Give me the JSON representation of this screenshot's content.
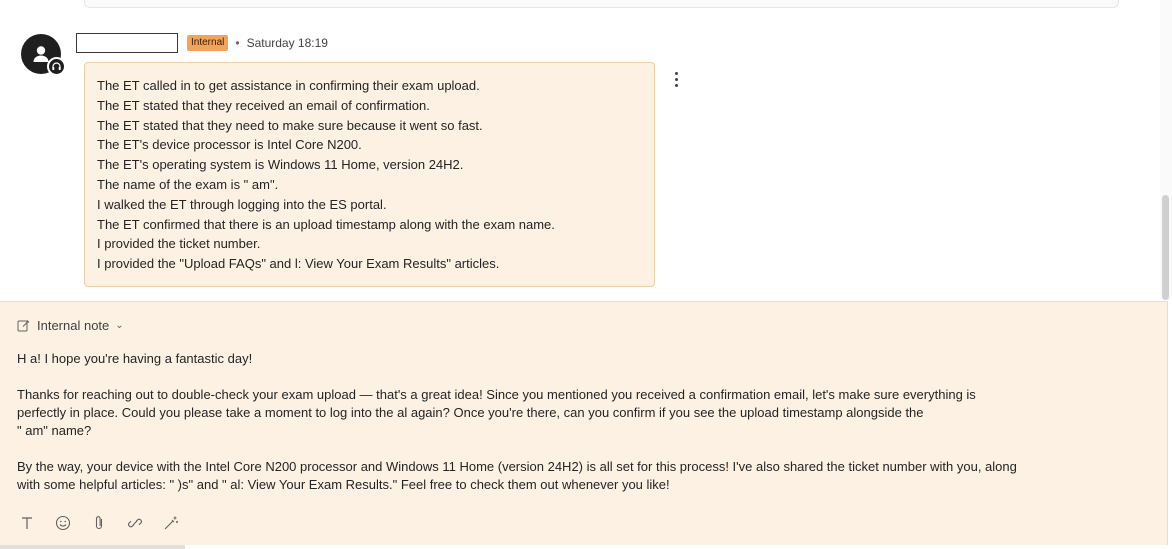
{
  "message": {
    "badge": "Internal",
    "separator": "•",
    "timestamp": "Saturday 18:19",
    "lines": [
      "The ET called in to get assistance in confirming their exam upload.",
      "The ET stated that they received an email of confirmation.",
      "The ET stated that they need to make sure because it went so fast.",
      "The ET's device processor is Intel Core N200.",
      "The ET's operating system is Windows 11 Home, version 24H2.",
      "The name of the exam is \"          am\".",
      "I walked the ET through logging into the ES portal.",
      "The ET confirmed that there is an upload timestamp along with the exam name.",
      "I provided the ticket number.",
      "I provided the \"Upload FAQs\" and                         l: View Your Exam Results\" articles."
    ]
  },
  "composer": {
    "mode_label": "Internal note",
    "paragraphs": [
      [
        "H            a! I hope you're having a fantastic day!"
      ],
      [
        "Thanks for reaching out to double-check your exam upload — that's a great idea! Since you mentioned you received a confirmation email, let's make sure everything is",
        "perfectly in place. Could you please take a moment to log into the                  al again? Once you're there, can you confirm if you see the upload timestamp alongside the",
        "\"             am\" name?"
      ],
      [
        "By the way, your device with the Intel Core N200 processor and Windows 11 Home (version 24H2) is all set for this process! I've also shared the ticket number with you, along",
        "with some helpful articles: \"                 )s\" and \"                      al: View Your Exam Results.\" Feel free to check them out whenever you like!"
      ]
    ]
  },
  "icons": {
    "avatar": "person-icon",
    "badge": "headset-icon",
    "more": "more-vertical-icon",
    "note": "note-edit-icon",
    "toolbar": [
      "text-format-icon",
      "emoji-icon",
      "attach-icon",
      "link-icon",
      "magic-wand-icon"
    ]
  },
  "colors": {
    "bubble_bg": "#fdf1e4",
    "bubble_border": "#f2cfa6",
    "badge_bg": "#f3a35c",
    "avatar_bg": "#1f1f1f"
  }
}
